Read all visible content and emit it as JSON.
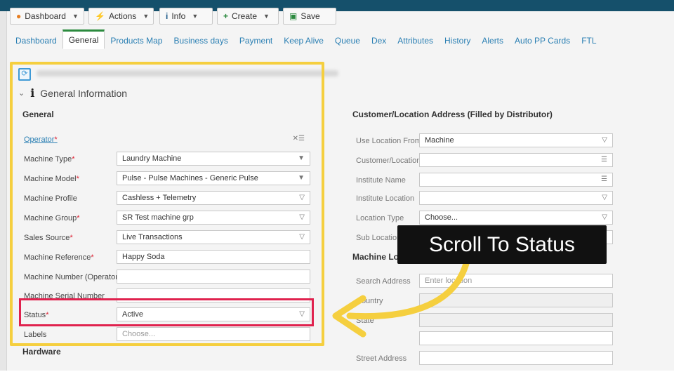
{
  "toolbar": {
    "dashboard": "Dashboard",
    "actions": "Actions",
    "info": "Info",
    "create": "Create",
    "save": "Save"
  },
  "tabs": [
    "Dashboard",
    "General",
    "Products Map",
    "Business days",
    "Payment",
    "Keep Alive",
    "Queue",
    "Dex",
    "Attributes",
    "History",
    "Alerts",
    "Auto PP Cards",
    "FTL"
  ],
  "active_tab": "General",
  "section": {
    "title": "General Information"
  },
  "general": {
    "title": "General",
    "fields": [
      {
        "label": "Operator",
        "required": true,
        "value": "",
        "type": "lookup"
      },
      {
        "label": "Machine Type",
        "required": true,
        "value": "Laundry Machine",
        "type": "select"
      },
      {
        "label": "Machine Model",
        "required": true,
        "value": "Pulse - Pulse Machines - Generic Pulse",
        "type": "select"
      },
      {
        "label": "Machine Profile",
        "required": false,
        "value": "Cashless + Telemetry",
        "type": "select2"
      },
      {
        "label": "Machine Group",
        "required": true,
        "value": "SR Test machine grp",
        "type": "select2"
      },
      {
        "label": "Sales Source",
        "required": true,
        "value": "Live Transactions",
        "type": "select2"
      },
      {
        "label": "Machine Reference",
        "required": true,
        "value": "Happy Soda",
        "type": "text"
      },
      {
        "label": "Machine Number (Operator)",
        "required": false,
        "value": "",
        "type": "text"
      },
      {
        "label": "Machine Serial Number",
        "required": false,
        "value": "",
        "type": "text"
      },
      {
        "label": "Status",
        "required": true,
        "value": "Active",
        "type": "select2"
      },
      {
        "label": "Labels",
        "required": false,
        "value": "",
        "placeholder": "Choose...",
        "type": "text"
      }
    ]
  },
  "hardware": {
    "title": "Hardware"
  },
  "address": {
    "title": "Customer/Location Address (Filled by Distributor)",
    "fields": [
      {
        "label": "Use Location From",
        "value": "Machine"
      },
      {
        "label": "Customer/Location",
        "value": ""
      },
      {
        "label": "Institute Name",
        "value": ""
      },
      {
        "label": "Institute Location",
        "value": ""
      },
      {
        "label": "Location Type",
        "value": "Choose..."
      },
      {
        "label": "Sub Location",
        "value": ""
      }
    ]
  },
  "machine_location": {
    "title": "Machine Lo",
    "fields": [
      {
        "label": "Search Address",
        "placeholder": "Enter location"
      },
      {
        "label": "Country",
        "value": ""
      },
      {
        "label": "State",
        "value": ""
      },
      {
        "label": "",
        "value": ""
      },
      {
        "label": "Street Address",
        "value": ""
      }
    ]
  },
  "callout": {
    "text": "Scroll To Status"
  },
  "colors": {
    "highlight": "#f5cf3f",
    "status_box": "#e0224e",
    "link": "#2a7fb3",
    "header": "#15506b"
  }
}
